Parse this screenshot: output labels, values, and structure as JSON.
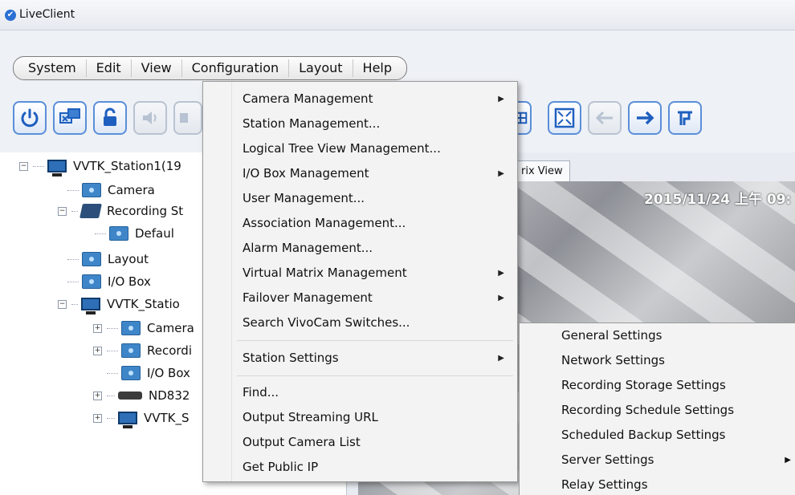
{
  "window": {
    "title": "LiveClient"
  },
  "menubar": [
    "System",
    "Edit",
    "View",
    "Configuration",
    "Layout",
    "Help"
  ],
  "toolbar": {
    "left_buttons": [
      "power-icon",
      "remote-desktop-icon",
      "lock-icon",
      "speaker-icon",
      "partial-icon"
    ],
    "right_buttons": [
      "layout-grid-icon",
      "fullscreen-icon",
      "back-arrow-icon",
      "forward-arrow-icon",
      "routing-icon"
    ]
  },
  "tree": {
    "items": [
      {
        "label": "VVTK_Station1(19",
        "icon": "monitor-icon",
        "expander": "−"
      },
      {
        "label": "Camera",
        "icon": "folder-icon"
      },
      {
        "label": "Recording St",
        "icon": "recording-folder-icon",
        "expander": "−"
      },
      {
        "label": "Defaul",
        "icon": "folder-icon"
      },
      {
        "label": "Layout",
        "icon": "folder-icon"
      },
      {
        "label": "I/O Box",
        "icon": "folder-icon"
      },
      {
        "label": "VVTK_Statio",
        "icon": "monitor-icon",
        "expander": "−"
      },
      {
        "label": "Camera",
        "icon": "folder-icon",
        "expander": "+"
      },
      {
        "label": "Recordi",
        "icon": "folder-icon",
        "expander": "+"
      },
      {
        "label": "I/O Box",
        "icon": "folder-icon"
      },
      {
        "label": "ND832",
        "icon": "recorder-icon",
        "expander": "+"
      },
      {
        "label": "VVTK_S",
        "icon": "monitor-icon",
        "expander": "+"
      }
    ]
  },
  "view_tab": {
    "label": "rix View"
  },
  "video": {
    "timestamp": "2015/11/24 上午 09:"
  },
  "configuration_menu": {
    "items": [
      {
        "label": "Camera Management",
        "submenu": true
      },
      {
        "label": "Station Management...",
        "submenu": false
      },
      {
        "label": "Logical Tree View Management...",
        "submenu": false
      },
      {
        "label": "I/O Box Management",
        "submenu": true
      },
      {
        "label": "User Management...",
        "submenu": false
      },
      {
        "label": "Association Management...",
        "submenu": false
      },
      {
        "label": "Alarm Management...",
        "submenu": false
      },
      {
        "label": "Virtual Matrix Management",
        "submenu": true
      },
      {
        "label": "Failover Management",
        "submenu": true
      },
      {
        "label": "Search VivoCam Switches...",
        "submenu": false
      },
      {
        "label": "Station Settings",
        "submenu": true
      },
      {
        "label": "Find...",
        "submenu": false
      },
      {
        "label": "Output Streaming URL",
        "submenu": false
      },
      {
        "label": "Output Camera List",
        "submenu": false
      },
      {
        "label": "Get Public IP",
        "submenu": false
      }
    ]
  },
  "station_settings_submenu": {
    "items": [
      {
        "label": "General Settings",
        "submenu": false
      },
      {
        "label": "Network Settings",
        "submenu": false
      },
      {
        "label": "Recording Storage Settings",
        "submenu": false
      },
      {
        "label": "Recording Schedule Settings",
        "submenu": false
      },
      {
        "label": "Scheduled Backup Settings",
        "submenu": false
      },
      {
        "label": "Server Settings",
        "submenu": true
      },
      {
        "label": "Relay Settings",
        "submenu": false
      }
    ]
  },
  "colors": {
    "accent": "#5a8fd8",
    "menu_bg": "#f3f3f3",
    "tree_bg": "#ffffff"
  }
}
